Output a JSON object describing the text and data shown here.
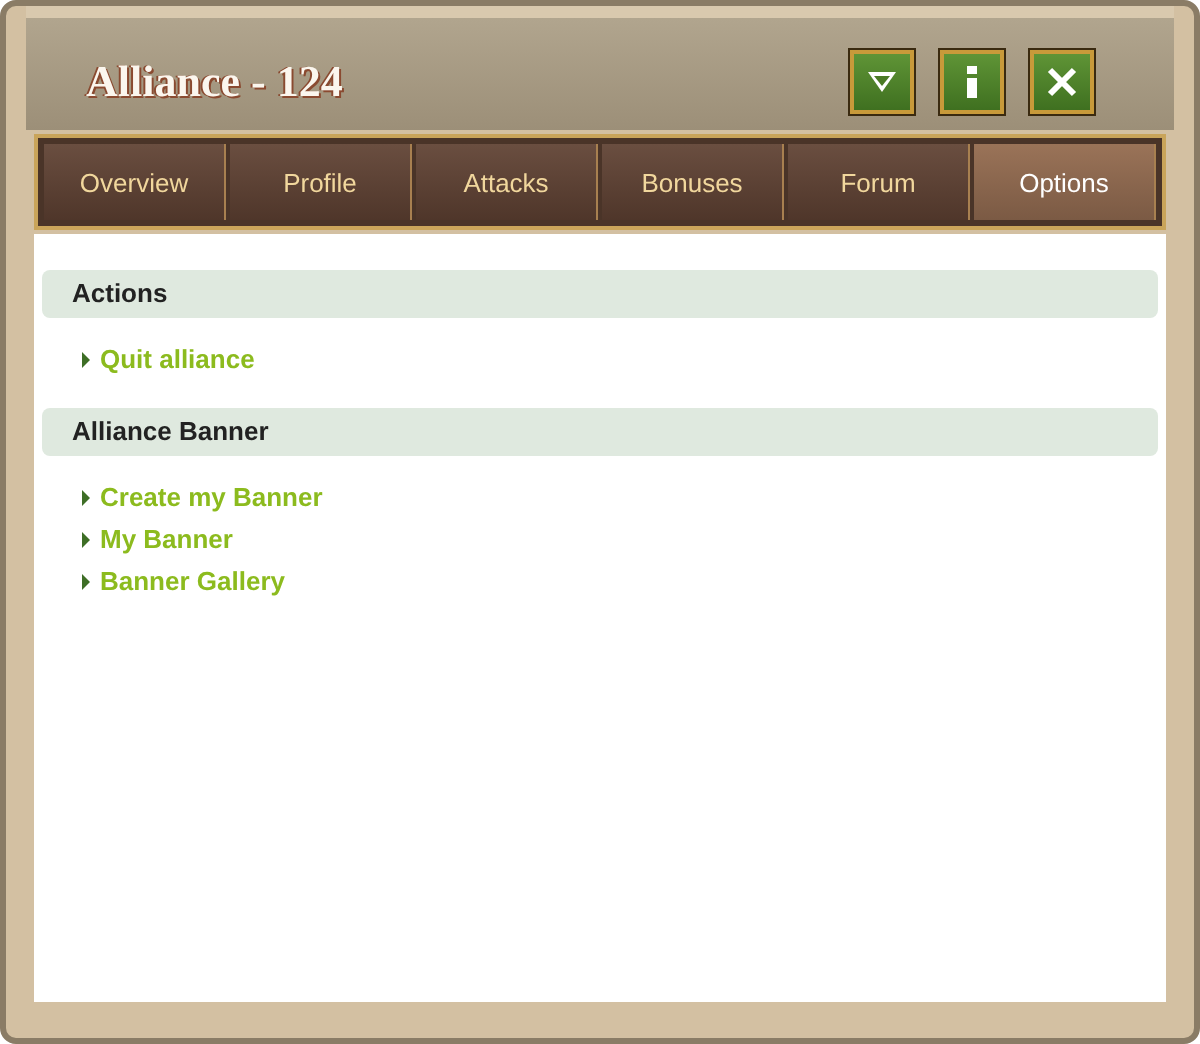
{
  "window": {
    "title": "Alliance - 124"
  },
  "tabs": [
    {
      "label": "Overview",
      "selected": false
    },
    {
      "label": "Profile",
      "selected": false
    },
    {
      "label": "Attacks",
      "selected": false
    },
    {
      "label": "Bonuses",
      "selected": false
    },
    {
      "label": "Forum",
      "selected": false
    },
    {
      "label": "Options",
      "selected": true
    }
  ],
  "sections": [
    {
      "title": "Actions",
      "links": [
        "Quit alliance"
      ]
    },
    {
      "title": "Alliance Banner",
      "links": [
        "Create my Banner",
        "My Banner",
        "Banner Gallery"
      ]
    }
  ]
}
